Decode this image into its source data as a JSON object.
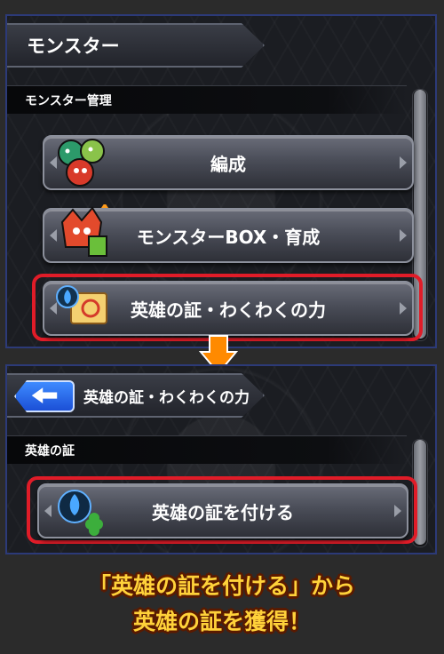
{
  "screen1": {
    "title": "モンスター",
    "section": "モンスター管理",
    "buttons": [
      {
        "label": "編成"
      },
      {
        "label": "モンスターBOX・育成"
      },
      {
        "label": "英雄の証・わくわくの力"
      }
    ]
  },
  "screen2": {
    "title": "英雄の証・わくわくの力",
    "section": "英雄の証",
    "buttons": [
      {
        "label": "英雄の証を付ける"
      }
    ]
  },
  "caption": {
    "line1": "「英雄の証を付ける」から",
    "line2": "英雄の証を獲得！"
  },
  "colors": {
    "highlight": "#e01c28",
    "accent_arrow": "#ff8a00",
    "caption": "#ffd23a",
    "panel_border": "#2c3a78"
  },
  "icons": {
    "back": "back-arrow-icon",
    "down": "down-arrow-icon"
  }
}
